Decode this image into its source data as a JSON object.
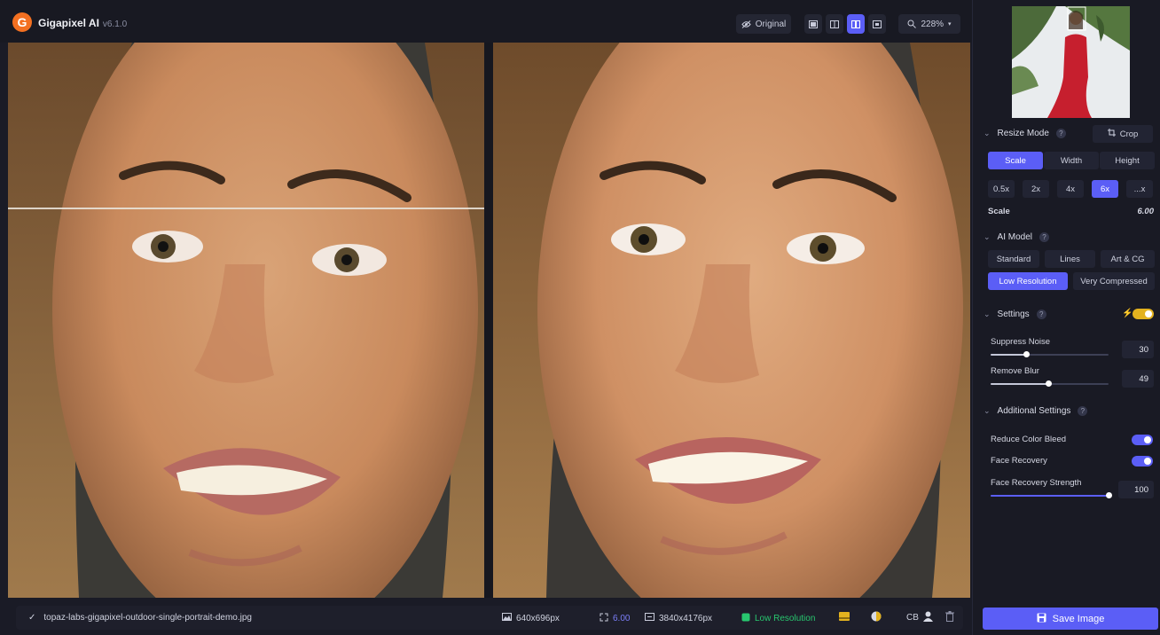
{
  "app": {
    "name": "Gigapixel AI",
    "version": "v6.1.0",
    "logo_letter": "G"
  },
  "toolbar": {
    "original_label": "Original",
    "zoom_label": "228%"
  },
  "statusbar": {
    "filename": "topaz-labs-gigapixel-outdoor-single-portrait-demo.jpg",
    "input_size": "640x696px",
    "scale": "6.00",
    "output_size": "3840x4176px",
    "model": "Low Resolution",
    "cb_label": "CB"
  },
  "sidebar": {
    "resize_mode": {
      "title": "Resize Mode",
      "crop_label": "Crop",
      "modes": [
        "Scale",
        "Width",
        "Height"
      ],
      "active_mode": "Scale",
      "scales": [
        "0.5x",
        "2x",
        "4x",
        "6x",
        "...x"
      ],
      "active_scale": "6x",
      "scale_label": "Scale",
      "scale_value": "6.00"
    },
    "ai_model": {
      "title": "AI Model",
      "row1": [
        "Standard",
        "Lines",
        "Art & CG"
      ],
      "row2": [
        "Low Resolution",
        "Very Compressed"
      ],
      "active": "Low Resolution"
    },
    "settings": {
      "title": "Settings",
      "suppress_noise_label": "Suppress Noise",
      "suppress_noise_value": "30",
      "suppress_noise_level": 0.3,
      "remove_blur_label": "Remove Blur",
      "remove_blur_value": "49",
      "remove_blur_level": 0.49
    },
    "additional": {
      "title": "Additional Settings",
      "reduce_color_bleed_label": "Reduce Color Bleed",
      "face_recovery_label": "Face Recovery",
      "face_recovery_strength_label": "Face Recovery Strength",
      "face_recovery_strength_value": "100",
      "face_recovery_strength_level": 1.0
    },
    "save_label": "Save Image"
  },
  "colors": {
    "accent": "#5b5ef6",
    "brand_orange": "#f37021",
    "toggle_yellow": "#e3b21f",
    "model_green": "#28c76f"
  }
}
